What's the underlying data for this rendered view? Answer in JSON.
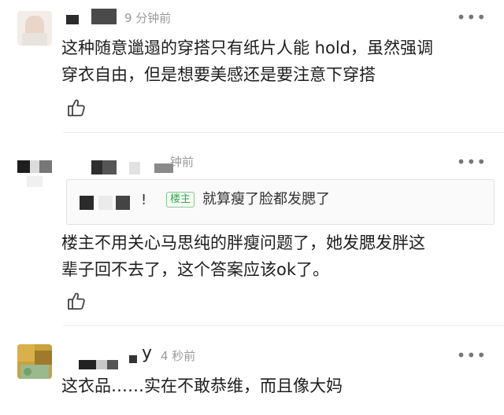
{
  "comments": [
    {
      "time": "9 分钟前",
      "more": "•••",
      "text_line1": "这种随意邋遢的穿搭只有纸片人能 hold，虽然强调",
      "text_line2": "穿衣自由，但是想要美感还是要注意下穿搭"
    },
    {
      "time": "钟前",
      "more": "•••",
      "quote": {
        "reply_mark": "!",
        "badge": "楼主",
        "text": "就算瘦了脸都发腮了"
      },
      "text_line1": "楼主不用关心马思纯的胖瘦问题了，她发腮发胖这",
      "text_line2": "辈子回不去了，这个答案应该ok了。"
    },
    {
      "username_tail": "y",
      "time": "4 秒前",
      "more": "•••",
      "text_line1": "这衣品……实在不敢恭维，而且像大妈"
    }
  ],
  "icons": {
    "like": "thumbs-up-icon",
    "more": "more-dots-icon"
  },
  "colors": {
    "badge_green": "#3aa64e",
    "time_gray": "#9a9a9a"
  }
}
